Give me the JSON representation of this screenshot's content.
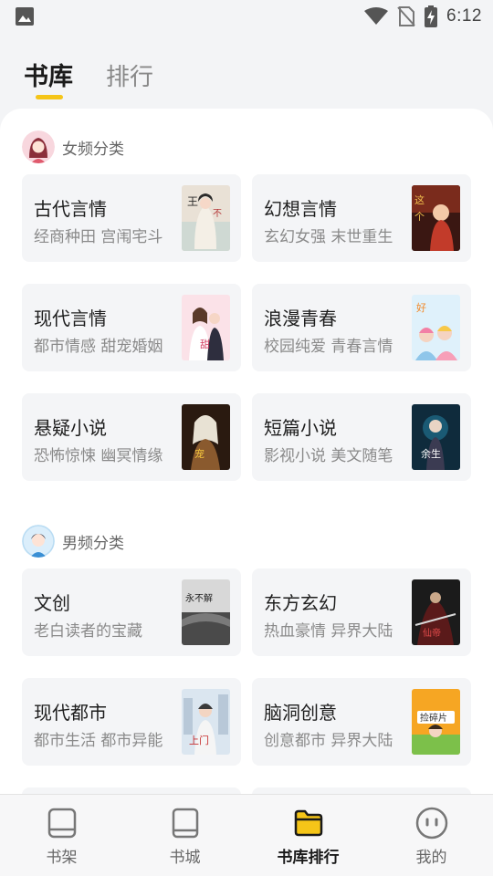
{
  "status_bar": {
    "time": "6:12",
    "icons": [
      "image-icon",
      "wifi-icon",
      "no-sim-icon",
      "battery-charging-icon"
    ]
  },
  "top_tabs": [
    {
      "label": "书库",
      "active": true
    },
    {
      "label": "排行",
      "active": false
    }
  ],
  "sections": [
    {
      "title": "女频分类",
      "avatar": "female-avatar-icon",
      "cards": [
        {
          "title": "古代言情",
          "subtitle": "经商种田 宫闱宅斗",
          "cover": "ancient-romance-cover"
        },
        {
          "title": "幻想言情",
          "subtitle": "玄幻女强 末世重生",
          "cover": "fantasy-romance-cover"
        },
        {
          "title": "现代言情",
          "subtitle": "都市情感 甜宠婚姻",
          "cover": "modern-romance-cover"
        },
        {
          "title": "浪漫青春",
          "subtitle": "校园纯爱 青春言情",
          "cover": "youth-romance-cover"
        },
        {
          "title": "悬疑小说",
          "subtitle": "恐怖惊悚 幽冥情缘",
          "cover": "suspense-cover"
        },
        {
          "title": "短篇小说",
          "subtitle": "影视小说 美文随笔",
          "cover": "short-story-cover"
        }
      ]
    },
    {
      "title": "男频分类",
      "avatar": "male-avatar-icon",
      "cards": [
        {
          "title": "文创",
          "subtitle": "老白读者的宝藏",
          "cover": "creative-cover"
        },
        {
          "title": "东方玄幻",
          "subtitle": "热血豪情 异界大陆",
          "cover": "eastern-fantasy-cover"
        },
        {
          "title": "现代都市",
          "subtitle": "都市生活 都市异能",
          "cover": "urban-cover"
        },
        {
          "title": "脑洞创意",
          "subtitle": "创意都市 异界大陆",
          "cover": "creative-idea-cover"
        }
      ]
    }
  ],
  "bottom_nav": [
    {
      "label": "书架",
      "icon": "bookshelf-icon",
      "active": false
    },
    {
      "label": "书城",
      "icon": "book-icon",
      "active": false
    },
    {
      "label": "书库排行",
      "icon": "folder-icon",
      "active": true
    },
    {
      "label": "我的",
      "icon": "profile-face-icon",
      "active": false
    }
  ],
  "colors": {
    "accent": "#f5c518",
    "background": "#f3f4f6",
    "card": "#f4f5f7",
    "text_primary": "#1e1e1e",
    "text_secondary": "#8a8a8a"
  }
}
